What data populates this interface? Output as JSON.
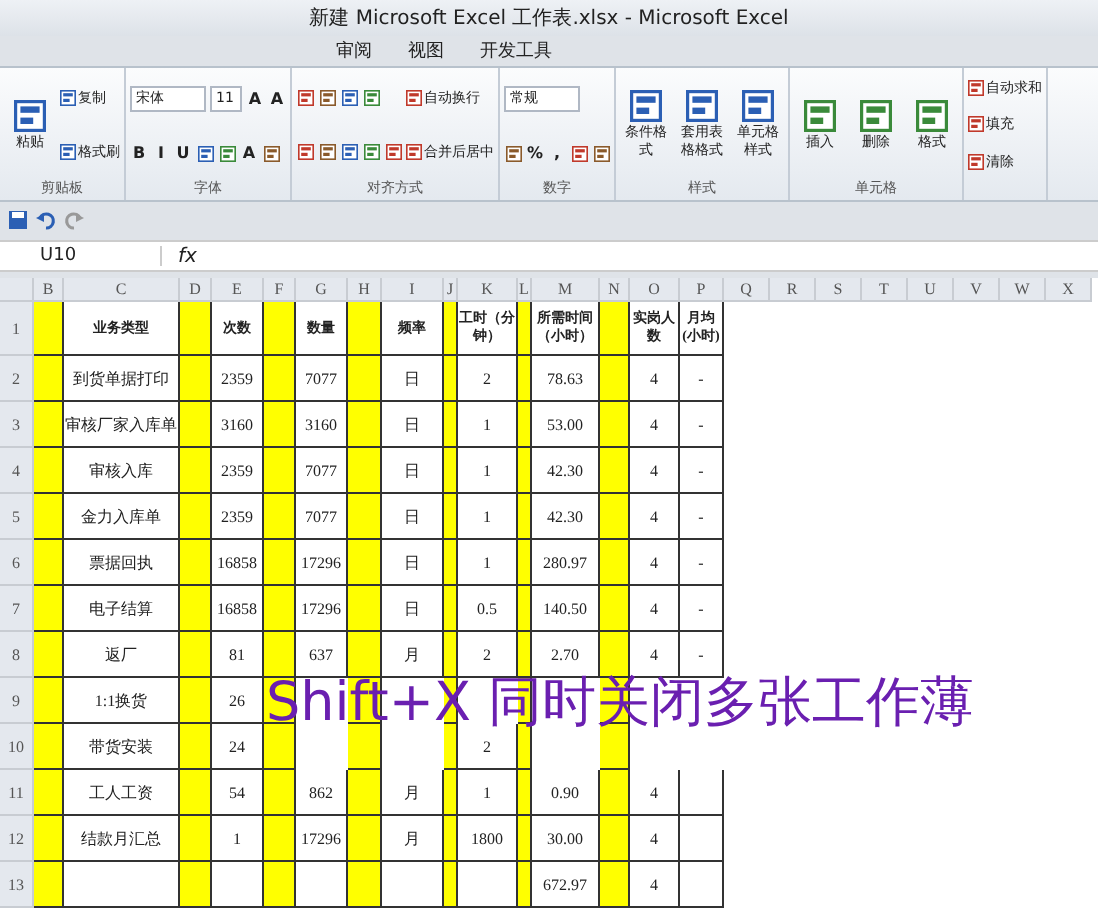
{
  "window": {
    "title": "新建 Microsoft Excel 工作表.xlsx - Microsoft Excel"
  },
  "tabs": [
    {
      "label": "审阅",
      "selected": false
    },
    {
      "label": "视图",
      "selected": false
    },
    {
      "label": "开发工具",
      "selected": false
    }
  ],
  "ribbon": [
    {
      "label": "剪贴板",
      "columns": [
        [
          [
            {
              "kind": "large",
              "label": "粘贴"
            }
          ]
        ],
        [
          [
            {
              "kind": "small",
              "label": "复制"
            }
          ],
          [
            {
              "kind": "small",
              "label": "格式刷"
            }
          ]
        ]
      ]
    },
    {
      "label": "字体",
      "columns": [
        [
          [
            {
              "kind": "field",
              "label": "宋体"
            },
            {
              "kind": "field",
              "label": "11"
            },
            {
              "kind": "glyph",
              "label": "A"
            },
            {
              "kind": "glyph",
              "label": "A"
            }
          ],
          [
            {
              "kind": "glyph",
              "label": "B"
            },
            {
              "kind": "glyph",
              "label": "I"
            },
            {
              "kind": "glyph",
              "label": "U"
            },
            {
              "kind": "icon"
            },
            {
              "kind": "icon"
            },
            {
              "kind": "glyph",
              "label": "A"
            },
            {
              "kind": "icon"
            }
          ]
        ]
      ]
    },
    {
      "label": "对齐方式",
      "columns": [
        [
          [
            {
              "kind": "icon"
            },
            {
              "kind": "icon"
            },
            {
              "kind": "icon"
            },
            {
              "kind": "icon"
            }
          ],
          [
            {
              "kind": "icon"
            },
            {
              "kind": "icon"
            },
            {
              "kind": "icon"
            },
            {
              "kind": "icon"
            },
            {
              "kind": "icon"
            }
          ]
        ],
        [
          [
            {
              "kind": "small",
              "label": "自动换行"
            }
          ],
          [
            {
              "kind": "small",
              "label": "合并后居中"
            }
          ]
        ]
      ]
    },
    {
      "label": "数字",
      "columns": [
        [
          [
            {
              "kind": "field",
              "label": "常规"
            }
          ],
          [
            {
              "kind": "icon"
            },
            {
              "kind": "glyph",
              "label": "%"
            },
            {
              "kind": "glyph",
              "label": ","
            },
            {
              "kind": "icon"
            },
            {
              "kind": "icon"
            }
          ]
        ]
      ]
    },
    {
      "label": "样式",
      "columns": [
        [
          [
            {
              "kind": "large",
              "label": "条件格式"
            }
          ]
        ],
        [
          [
            {
              "kind": "large",
              "label": "套用表格格式"
            }
          ]
        ],
        [
          [
            {
              "kind": "large",
              "label": "单元格样式"
            }
          ]
        ]
      ]
    },
    {
      "label": "单元格",
      "columns": [
        [
          [
            {
              "kind": "large",
              "label": "插入"
            }
          ]
        ],
        [
          [
            {
              "kind": "large",
              "label": "删除"
            }
          ]
        ],
        [
          [
            {
              "kind": "large",
              "label": "格式"
            }
          ]
        ]
      ]
    },
    {
      "columns": [
        [
          [
            {
              "kind": "small",
              "label": "自动求和"
            }
          ],
          [
            {
              "kind": "small",
              "label": "填充"
            }
          ],
          [
            {
              "kind": "small",
              "label": "清除"
            }
          ]
        ]
      ]
    }
  ],
  "name_box": "U10",
  "function_symbol": "fx",
  "sheet": {
    "columns": [
      {
        "letter": "B",
        "highlighted": true
      },
      {
        "letter": "C",
        "highlighted": false
      },
      {
        "letter": "D",
        "highlighted": true
      },
      {
        "letter": "E",
        "highlighted": false
      },
      {
        "letter": "F",
        "highlighted": true
      },
      {
        "letter": "G",
        "highlighted": false
      },
      {
        "letter": "H",
        "highlighted": true
      },
      {
        "letter": "I",
        "highlighted": false
      },
      {
        "letter": "J",
        "highlighted": true
      },
      {
        "letter": "K",
        "highlighted": false
      },
      {
        "letter": "L",
        "highlighted": true
      },
      {
        "letter": "M",
        "highlighted": false
      },
      {
        "letter": "N",
        "highlighted": true
      },
      {
        "letter": "O",
        "highlighted": false
      },
      {
        "letter": "P",
        "highlighted": false
      },
      {
        "letter": "Q",
        "highlighted": false
      },
      {
        "letter": "R",
        "highlighted": false
      },
      {
        "letter": "S",
        "highlighted": false
      },
      {
        "letter": "T",
        "highlighted": false
      },
      {
        "letter": "U",
        "highlighted": false
      },
      {
        "letter": "V",
        "highlighted": false
      },
      {
        "letter": "W",
        "highlighted": false
      },
      {
        "letter": "X",
        "highlighted": false
      }
    ],
    "rows": [
      {
        "number": "1",
        "kind": "header",
        "cells": {
          "C": "业务类型",
          "E": "次数",
          "G": "数量",
          "I": "频率",
          "K": "工时（分钟）",
          "M": "所需时间（小时）",
          "O": "实岗人数",
          "P": "月均(小时)"
        }
      },
      {
        "number": "2",
        "cells": {
          "C": "到货单据打印",
          "E": "2359",
          "G": "7077",
          "I": "日",
          "K": "2",
          "M": "78.63",
          "O": "4",
          "P": "-"
        }
      },
      {
        "number": "3",
        "cells": {
          "C": "审核厂家入库单",
          "E": "3160",
          "G": "3160",
          "I": "日",
          "K": "1",
          "M": "53.00",
          "O": "4",
          "P": "-"
        }
      },
      {
        "number": "4",
        "cells": {
          "C": "审核入库",
          "E": "2359",
          "G": "7077",
          "I": "日",
          "K": "1",
          "M": "42.30",
          "O": "4",
          "P": "-"
        }
      },
      {
        "number": "5",
        "cells": {
          "C": "金力入库单",
          "E": "2359",
          "G": "7077",
          "I": "日",
          "K": "1",
          "M": "42.30",
          "O": "4",
          "P": "-"
        }
      },
      {
        "number": "6",
        "cells": {
          "C": "票据回执",
          "E": "16858",
          "G": "17296",
          "I": "日",
          "K": "1",
          "M": "280.97",
          "O": "4",
          "P": "-"
        }
      },
      {
        "number": "7",
        "cells": {
          "C": "电子结算",
          "E": "16858",
          "G": "17296",
          "I": "日",
          "K": "0.5",
          "M": "140.50",
          "O": "4",
          "P": "-"
        }
      },
      {
        "number": "8",
        "cells": {
          "C": "返厂",
          "E": "81",
          "G": "637",
          "I": "月",
          "K": "2",
          "M": "2.70",
          "O": "4",
          "P": "-"
        }
      },
      {
        "number": "9",
        "cells": {
          "C": "1:1换货",
          "E": "26"
        }
      },
      {
        "number": "10",
        "cells": {
          "C": "带货安装",
          "E": "24",
          "K": "2"
        }
      },
      {
        "number": "11",
        "cells": {
          "C": "工人工资",
          "E": "54",
          "G": "862",
          "I": "月",
          "K": "1",
          "M": "0.90",
          "O": "4"
        }
      },
      {
        "number": "12",
        "cells": {
          "C": "结款月汇总",
          "E": "1",
          "G": "17296",
          "I": "月",
          "K": "1800",
          "M": "30.00",
          "O": "4"
        }
      },
      {
        "number": "13",
        "cells": {
          "M": "672.97",
          "O": "4"
        }
      }
    ]
  },
  "caption": "Shift+X 同时关闭多张工作薄"
}
